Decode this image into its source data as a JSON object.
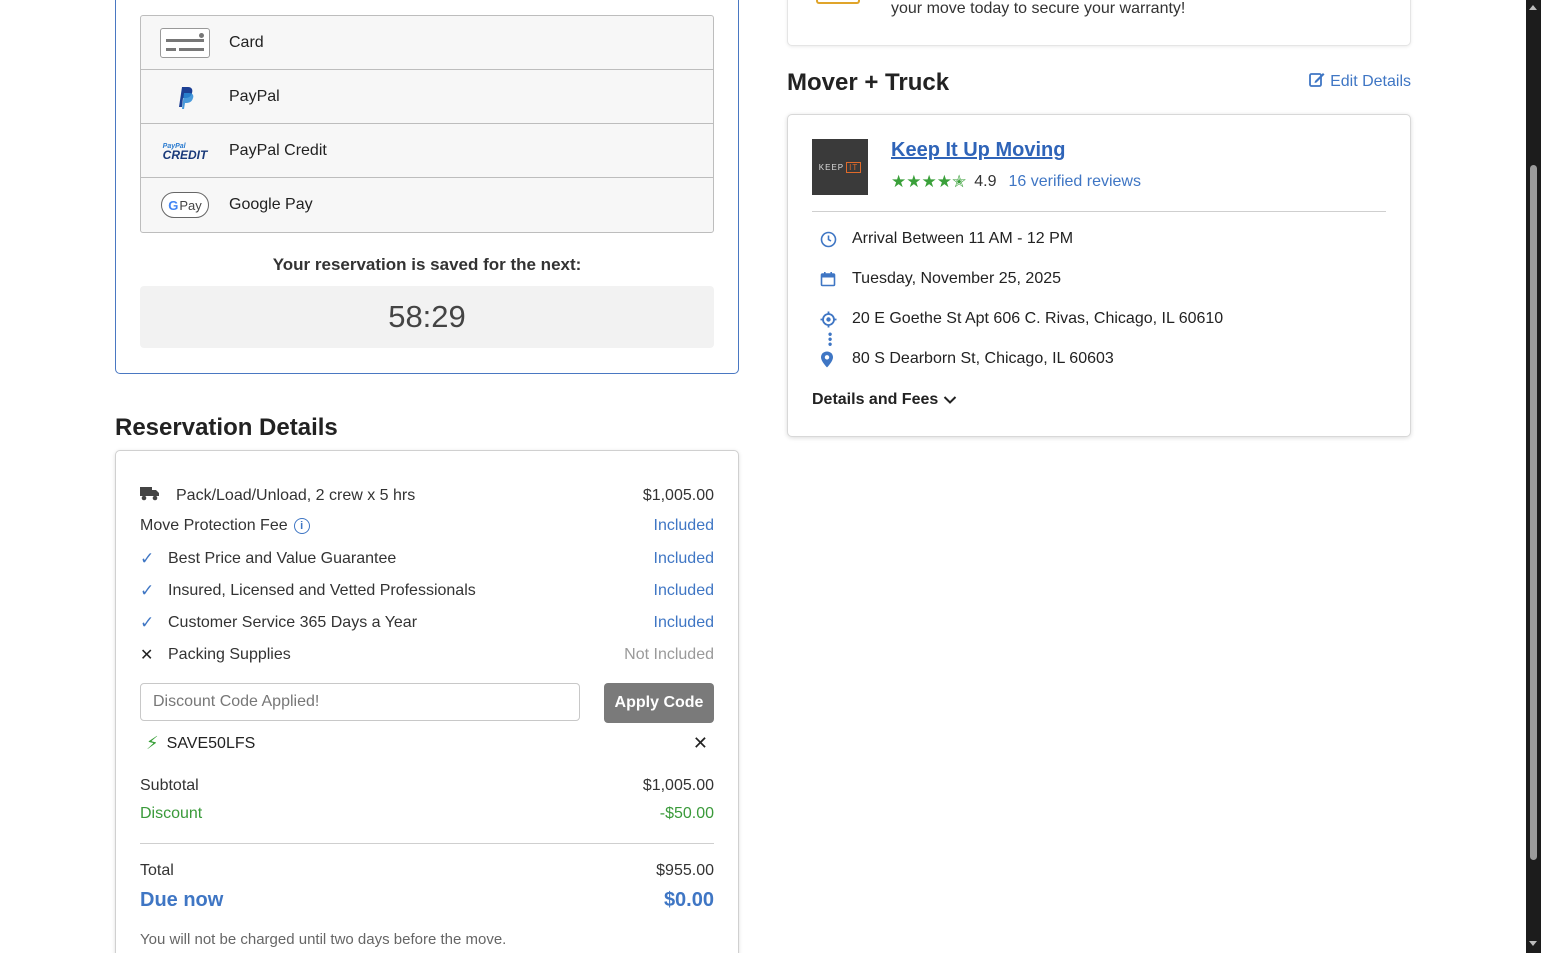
{
  "payment": {
    "methods": [
      {
        "label": "Card",
        "icon": "credit-card-icon"
      },
      {
        "label": "PayPal",
        "icon": "paypal-icon"
      },
      {
        "label": "PayPal Credit",
        "icon": "paypal-credit-icon"
      },
      {
        "label": "Google Pay",
        "icon": "google-pay-icon"
      }
    ],
    "paypal_credit_small": "PayPal",
    "paypal_credit_big": "CREDIT",
    "gpay_g": "G",
    "gpay_text": "Pay",
    "reservation_saved_label": "Your reservation is saved for the next:",
    "timer": "58:29"
  },
  "reservation": {
    "heading": "Reservation Details",
    "lines": [
      {
        "label": "Pack/Load/Unload, 2 crew x 5 hrs",
        "value": "$1,005.00"
      },
      {
        "label": "Move Protection Fee",
        "value": "Included"
      },
      {
        "label": "Best Price and Value Guarantee",
        "value": "Included"
      },
      {
        "label": "Insured, Licensed and Vetted Professionals",
        "value": "Included"
      },
      {
        "label": "Customer Service 365 Days a Year",
        "value": "Included"
      },
      {
        "label": "Packing Supplies",
        "value": "Not Included"
      }
    ],
    "discount_placeholder": "Discount Code Applied!",
    "apply_label": "Apply Code",
    "code": "SAVE50LFS",
    "subtotal_label": "Subtotal",
    "subtotal_value": "$1,005.00",
    "discount_label": "Discount",
    "discount_value": "-$50.00",
    "total_label": "Total",
    "total_value": "$955.00",
    "due_label": "Due now",
    "due_value": "$0.00",
    "note": "You will not be charged until two days before the move."
  },
  "warranty": {
    "text": "your move today to secure your warranty!"
  },
  "mover": {
    "heading": "Mover + Truck",
    "edit_label": "Edit Details",
    "logo_text": "KEEP",
    "logo_it": "IT",
    "name": "Keep It Up Moving",
    "stars": "★★★★✭",
    "rating": "4.9",
    "reviews": "16 verified reviews",
    "arrival": "Arrival Between 11 AM - 12 PM",
    "date": "Tuesday, November 25, 2025",
    "origin": "20 E Goethe St Apt 606 C. Rivas, Chicago, IL 60610",
    "destination": "80 S Dearborn St, Chicago, IL 60603",
    "details_fees_label": "Details and Fees"
  },
  "colors": {
    "accent": "#3f76c4",
    "success": "#3a9a3a",
    "border_blue": "#4a78c2",
    "button_grey": "#7a7a7a"
  }
}
